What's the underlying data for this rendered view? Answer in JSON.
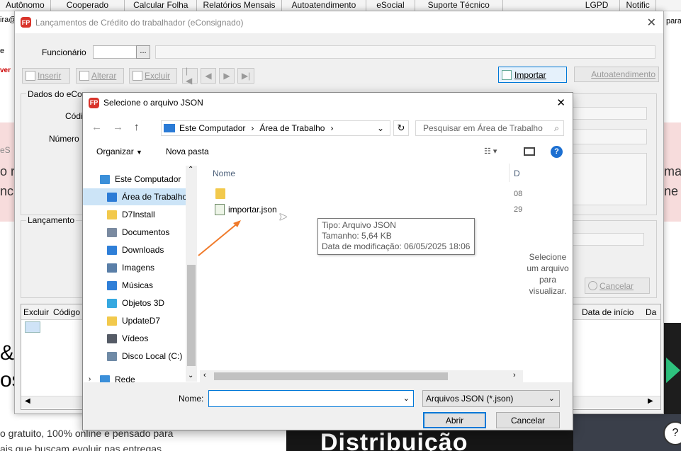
{
  "top_menu": [
    "Autônomo",
    "Cooperado",
    "Calcular Folha",
    "Relatórios Mensais",
    "Autoatendimento",
    "eSocial",
    "Suporte Técnico",
    "LGPD",
    "Notific"
  ],
  "background": {
    "left_frag_1": "ira@",
    "left_frag_2": "e",
    "left_frag_3": "ver",
    "left_frag_4": "eS",
    "left_frag_5": "o r",
    "left_frag_6": "nc",
    "left_big_1": "&",
    "left_big_2": "os",
    "bottom_text_1": "o gratuito, 100% online e pensado para",
    "bottom_text_2": "ais que buscam evoluir nas entregas",
    "bottom_banner": "Distribuição",
    "right_frag_1": "para",
    "right_frag_2": "ma",
    "right_frag_3": "ne",
    "help_icon": "?"
  },
  "main_window": {
    "title": "Lançamentos de Crédito do trabalhador (eConsignado)",
    "funcionario_label": "Funcionário",
    "funcionario_btn": "...",
    "toolbar": {
      "inserir": "Inserir",
      "alterar": "Alterar",
      "excluir": "Excluir"
    },
    "importar": "Importar",
    "autoatendimento": "Autoatendimento",
    "dados_label": "Dados do eCo",
    "codigo_label": "Códi",
    "numero_label": "Número",
    "lancamento_label": "Lançamento",
    "cancelar": "Cancelar",
    "preview_text": "Selecione um arquivo para visualizar.",
    "grid_headers": {
      "excluir": "Excluir",
      "codigo": "Código",
      "data_inicio": "Data de início",
      "da": "Da"
    }
  },
  "dialog": {
    "title": "Selecione o arquivo JSON",
    "breadcrumb": [
      "Este Computador",
      "Área de Trabalho"
    ],
    "search_placeholder": "Pesquisar em Área de Trabalho",
    "organizar": "Organizar",
    "nova_pasta": "Nova pasta",
    "tree": [
      {
        "label": "Este Computador",
        "icon": "computer-icon",
        "color": "#3b8fd9"
      },
      {
        "label": "Área de Trabalho",
        "icon": "desktop-icon",
        "color": "#2b7bd6",
        "selected": true
      },
      {
        "label": "D7Install",
        "icon": "folder-icon",
        "color": "#f2c94c"
      },
      {
        "label": "Documentos",
        "icon": "documents-icon",
        "color": "#7a8aa0"
      },
      {
        "label": "Downloads",
        "icon": "download-icon",
        "color": "#2f7fd8"
      },
      {
        "label": "Imagens",
        "icon": "images-icon",
        "color": "#5a7fa8"
      },
      {
        "label": "Músicas",
        "icon": "music-icon",
        "color": "#2f7fd8"
      },
      {
        "label": "Objetos 3D",
        "icon": "objects3d-icon",
        "color": "#35a8e0"
      },
      {
        "label": "UpdateD7",
        "icon": "folder-icon",
        "color": "#f2c94c"
      },
      {
        "label": "Vídeos",
        "icon": "videos-icon",
        "color": "#555b66"
      },
      {
        "label": "Disco Local (C:)",
        "icon": "drive-icon",
        "color": "#6f8aa6"
      },
      {
        "label": "Rede",
        "icon": "network-icon",
        "color": "#3b8fd9"
      }
    ],
    "col_nome": "Nome",
    "col_d": "D",
    "files": [
      {
        "name": "",
        "date": "08",
        "icon": "folder-icon"
      },
      {
        "name": "importar.json",
        "date": "29",
        "icon": "json-file-icon"
      }
    ],
    "tooltip": {
      "tipo": "Tipo: Arquivo JSON",
      "tamanho": "Tamanho: 5,64 KB",
      "data": "Data de modificação: 06/05/2025 18:06"
    },
    "nome_label": "Nome:",
    "nome_value": "",
    "filetype": "Arquivos JSON (*.json)",
    "abrir": "Abrir",
    "cancelar": "Cancelar"
  }
}
